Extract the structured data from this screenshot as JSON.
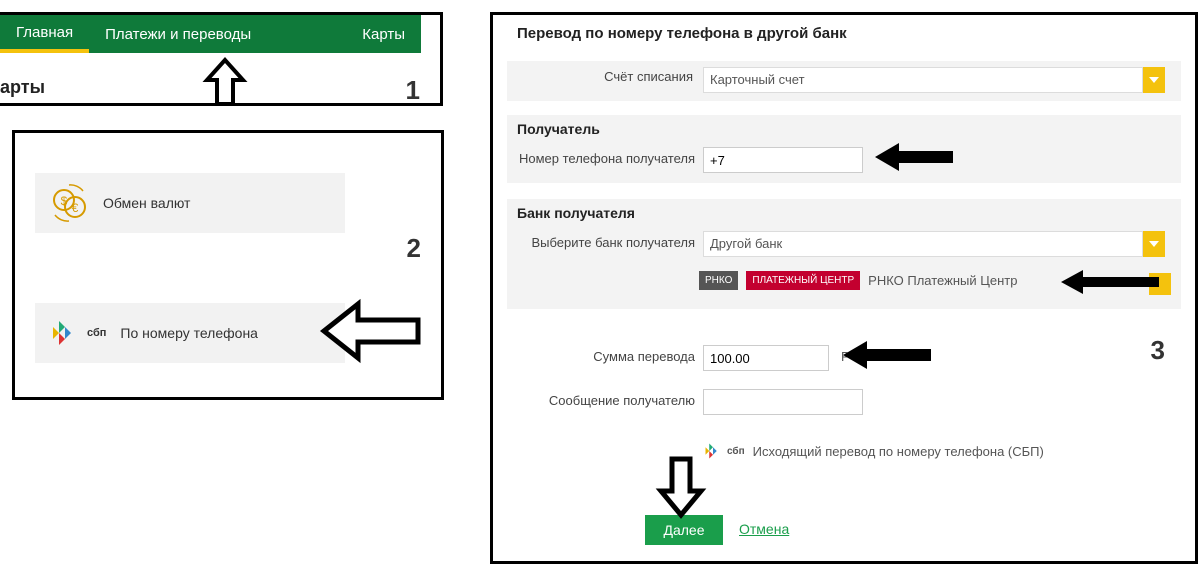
{
  "nav": {
    "tab_home": "Главная",
    "tab_payments": "Платежи и переводы",
    "tab_cards": "Карты"
  },
  "breadcrumb": "арты",
  "step1_number": "1",
  "options": {
    "currency_exchange": "Обмен валют",
    "by_phone": "По номеру телефона"
  },
  "step2_number": "2",
  "form": {
    "title": "Перевод по номеру телефона в другой банк",
    "account_label": "Счёт списания",
    "account_value": "Карточный счет",
    "recipient_section": "Получатель",
    "phone_label": "Номер телефона получателя",
    "phone_value": "+7",
    "bank_section": "Банк получателя",
    "bank_select_label": "Выберите банк получателя",
    "bank_select_value": "Другой банк",
    "rnko_badge1": "РНКО",
    "rnko_badge2": "ПЛАТЕЖНЫЙ ЦЕНТР",
    "rnko_text": "РНКО Платежный Центр",
    "amount_label": "Сумма перевода",
    "amount_value": "100.00",
    "amount_currency": "Р",
    "message_label": "Сообщение получателю",
    "sbp_note": "Исходящий перевод по номеру телефона (СБП)",
    "btn_next": "Далее",
    "btn_cancel": "Отмена"
  },
  "step3_number": "3",
  "sbp_label": "сбп"
}
